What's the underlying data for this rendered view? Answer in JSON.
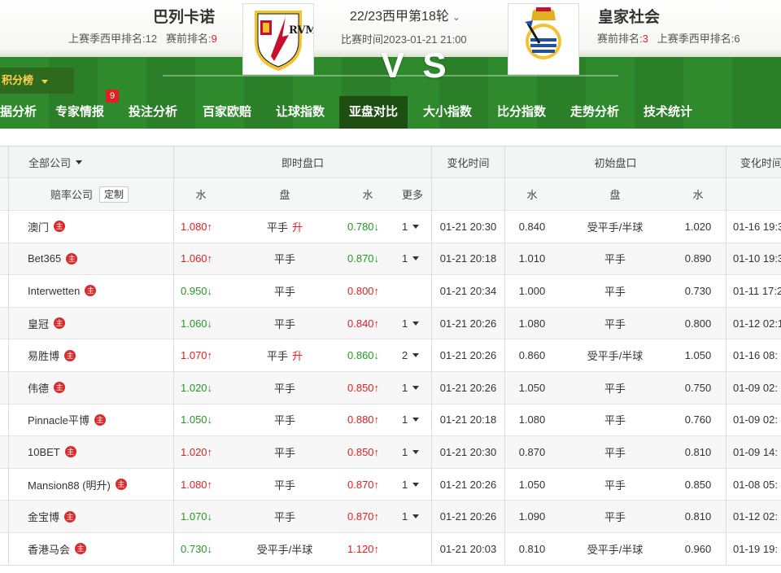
{
  "match": {
    "home_team": "巴列卡诺",
    "away_team": "皇家社会",
    "home_ranks": {
      "last_season_label": "上赛季西甲排名:",
      "last_season_value": "12",
      "pre_label": "赛前排名:",
      "pre_value": "9"
    },
    "away_ranks": {
      "pre_label": "赛前排名:",
      "pre_value": "3",
      "last_season_label": "上赛季西甲排名:",
      "last_season_value": "6"
    },
    "round": "22/23西甲第18轮",
    "time_label": "比赛时间",
    "time_value": "2023-01-21 21:00",
    "vs": "VS",
    "home_logo_text": "RVM"
  },
  "standings_label": "积分榜",
  "nav": {
    "items": [
      "据分析",
      "专家情报",
      "投注分析",
      "百家欧赔",
      "让球指数",
      "亚盘对比",
      "大小指数",
      "比分指数",
      "走势分析",
      "技术统计"
    ],
    "active": "亚盘对比",
    "badge": "9"
  },
  "table": {
    "headers": {
      "company": "全部公司",
      "live": "即时盘口",
      "change_time": "变化时间",
      "initial": "初始盘口",
      "change_time2": "变化时间"
    },
    "subheaders": {
      "odds_company": "赔率公司",
      "custom": "定制",
      "water1": "水",
      "handicap": "盘",
      "water2": "水",
      "more": "更多",
      "init_water1": "水",
      "init_handicap": "盘",
      "init_water2": "水"
    },
    "zhu": "主",
    "rows": [
      {
        "company": "澳门",
        "w1": "1.080↑",
        "w1dir": "up",
        "hc": "平手",
        "hcchg": "升",
        "w2": "0.780↓",
        "w2dir": "down",
        "more": "1",
        "time": "01-21 20:30",
        "iw1": "0.840",
        "ihc": "受平手/半球",
        "iw2": "1.020",
        "itime": "01-16 19:3"
      },
      {
        "company": "Bet365",
        "w1": "1.060↑",
        "w1dir": "up",
        "hc": "平手",
        "hcchg": "",
        "w2": "0.870↓",
        "w2dir": "down",
        "more": "1",
        "time": "01-21 20:18",
        "iw1": "1.010",
        "ihc": "平手",
        "iw2": "0.890",
        "itime": "01-10 19:3"
      },
      {
        "company": "Interwetten",
        "w1": "0.950↓",
        "w1dir": "down",
        "hc": "平手",
        "hcchg": "",
        "w2": "0.800↑",
        "w2dir": "up",
        "more": "",
        "time": "01-21 20:34",
        "iw1": "1.000",
        "ihc": "平手",
        "iw2": "0.730",
        "itime": "01-11 17:2"
      },
      {
        "company": "皇冠",
        "w1": "1.060↓",
        "w1dir": "down",
        "hc": "平手",
        "hcchg": "",
        "w2": "0.840↑",
        "w2dir": "up",
        "more": "1",
        "time": "01-21 20:26",
        "iw1": "1.080",
        "ihc": "平手",
        "iw2": "0.800",
        "itime": "01-12 02:1"
      },
      {
        "company": "易胜博",
        "w1": "1.070↑",
        "w1dir": "up",
        "hc": "平手",
        "hcchg": "升",
        "w2": "0.860↓",
        "w2dir": "down",
        "more": "2",
        "time": "01-21 20:26",
        "iw1": "0.860",
        "ihc": "受平手/半球",
        "iw2": "1.050",
        "itime": "01-16 08:"
      },
      {
        "company": "伟德",
        "w1": "1.020↓",
        "w1dir": "down",
        "hc": "平手",
        "hcchg": "",
        "w2": "0.850↑",
        "w2dir": "up",
        "more": "1",
        "time": "01-21 20:26",
        "iw1": "1.050",
        "ihc": "平手",
        "iw2": "0.750",
        "itime": "01-09 02:"
      },
      {
        "company": "Pinnacle平博",
        "w1": "1.050↓",
        "w1dir": "down",
        "hc": "平手",
        "hcchg": "",
        "w2": "0.880↑",
        "w2dir": "up",
        "more": "1",
        "time": "01-21 20:18",
        "iw1": "1.080",
        "ihc": "平手",
        "iw2": "0.760",
        "itime": "01-09 02:"
      },
      {
        "company": "10BET",
        "w1": "1.020↑",
        "w1dir": "up",
        "hc": "平手",
        "hcchg": "",
        "w2": "0.850↑",
        "w2dir": "up",
        "more": "1",
        "time": "01-21 20:30",
        "iw1": "0.870",
        "ihc": "平手",
        "iw2": "0.810",
        "itime": "01-09 14:"
      },
      {
        "company": "Mansion88 (明升)",
        "w1": "1.080↑",
        "w1dir": "up",
        "hc": "平手",
        "hcchg": "",
        "w2": "0.870↑",
        "w2dir": "up",
        "more": "1",
        "time": "01-21 20:26",
        "iw1": "1.050",
        "ihc": "平手",
        "iw2": "0.850",
        "itime": "01-08 05:"
      },
      {
        "company": "金宝博",
        "w1": "1.070↓",
        "w1dir": "down",
        "hc": "平手",
        "hcchg": "",
        "w2": "0.870↑",
        "w2dir": "up",
        "more": "1",
        "time": "01-21 20:26",
        "iw1": "1.090",
        "ihc": "平手",
        "iw2": "0.810",
        "itime": "01-12 02:"
      },
      {
        "company": "香港马会",
        "w1": "0.730↓",
        "w1dir": "down",
        "hc": "受平手/半球",
        "hcchg": "",
        "w2": "1.120↑",
        "w2dir": "up",
        "more": "",
        "time": "01-21 20:03",
        "iw1": "0.810",
        "ihc": "受平手/半球",
        "iw2": "0.960",
        "itime": "01-19 19:"
      }
    ]
  }
}
